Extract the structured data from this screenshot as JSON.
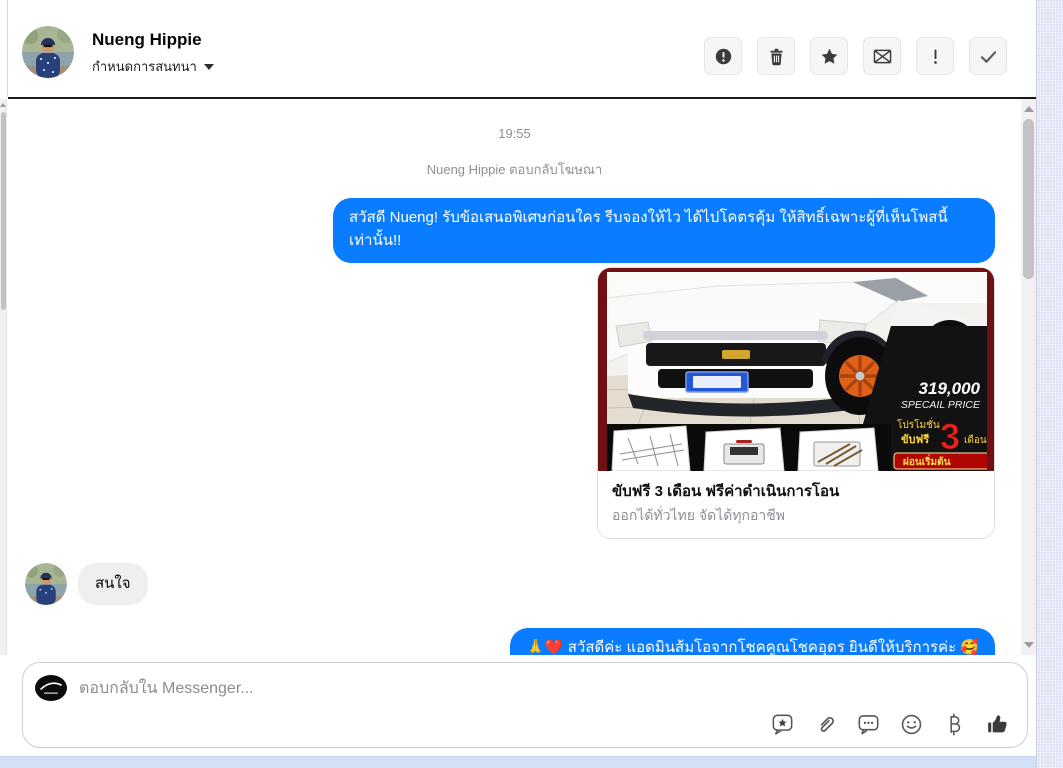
{
  "header": {
    "name": "Nueng Hippie",
    "menu_label": "กำหนดการสนทนา",
    "actions": [
      "report-icon",
      "delete-icon",
      "star-icon",
      "mark-unread-icon",
      "important-icon",
      "done-icon"
    ]
  },
  "chat": {
    "timestamp": "19:55",
    "context_note": "Nueng Hippie ตอบกลับโฆษณา",
    "outgoing_greeting": "สวัสดี Nueng! รับข้อเสนอพิเศษก่อนใคร รีบจองให้ไว ได้ไปโคตรคุ้ม ให้สิทธิ์เฉพาะผู้ที่เห็นโพสนี้เท่านั้น!!",
    "incoming_reply": "สนใจ",
    "outgoing_admin": "🙏❤️ สวัสดีค่ะ แอดมินส้มโอจากโชคคูณโชคอุดร ยินดีให้บริการค่ะ 🥰",
    "ad_card": {
      "title": "ขับฟรี 3 เดือน ฟรีค่าดำเนินการโอน",
      "subtitle": "ออกได้ทั่วไทย จัดได้ทุกอาชีพ",
      "price": "319,000",
      "price_label": "SPECAIL PRICE",
      "promo_label": "โปรโมชั่น",
      "promo_label2": "ขับฟรี",
      "promo_number": "3",
      "promo_unit": "เดือน",
      "ribbon": "ผ่อนเริ่มต้น"
    }
  },
  "composer": {
    "placeholder": "ตอบกลับใน Messenger...",
    "actions": [
      "sticker-icon",
      "attach-icon",
      "saved-replies-icon",
      "emoji-icon",
      "payment-icon",
      "like-icon"
    ]
  },
  "colors": {
    "accent_blue": "#0a7cff",
    "incoming_bubble": "#efeff0",
    "maroon": "#6f1014",
    "promo_yellow": "#ffd835",
    "promo_red": "#e8231f"
  }
}
